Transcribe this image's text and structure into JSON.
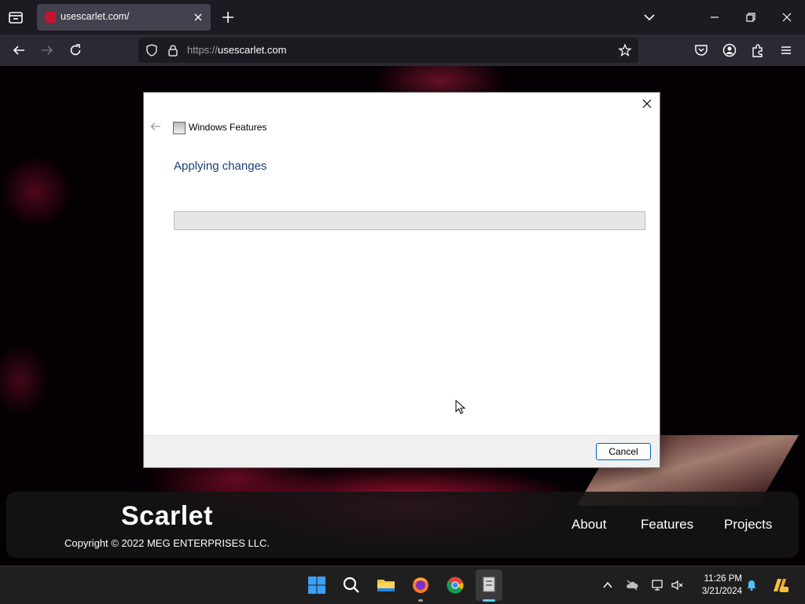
{
  "browser": {
    "tab": {
      "title": "usescarlet.com/"
    },
    "url": {
      "scheme": "https://",
      "host": "usescarlet.com"
    }
  },
  "page": {
    "brand": "Scarlet",
    "copyright": "Copyright © 2022 MEG ENTERPRISES LLC.",
    "nav": [
      "About",
      "Features",
      "Projects"
    ]
  },
  "dialog": {
    "app_title": "Windows Features",
    "heading": "Applying changes",
    "progress": 0,
    "cancel_label": "Cancel"
  },
  "taskbar": {
    "apps": [
      "start-icon",
      "search-icon",
      "file-explorer-icon",
      "firefox-icon",
      "chrome-icon",
      "windows-features-icon"
    ],
    "clock": {
      "time": "11:26 PM",
      "date": "3/21/2024"
    }
  },
  "colors": {
    "accent": "#c3132e",
    "dialog_heading": "#1e3c78",
    "button_border": "#0067c0"
  }
}
